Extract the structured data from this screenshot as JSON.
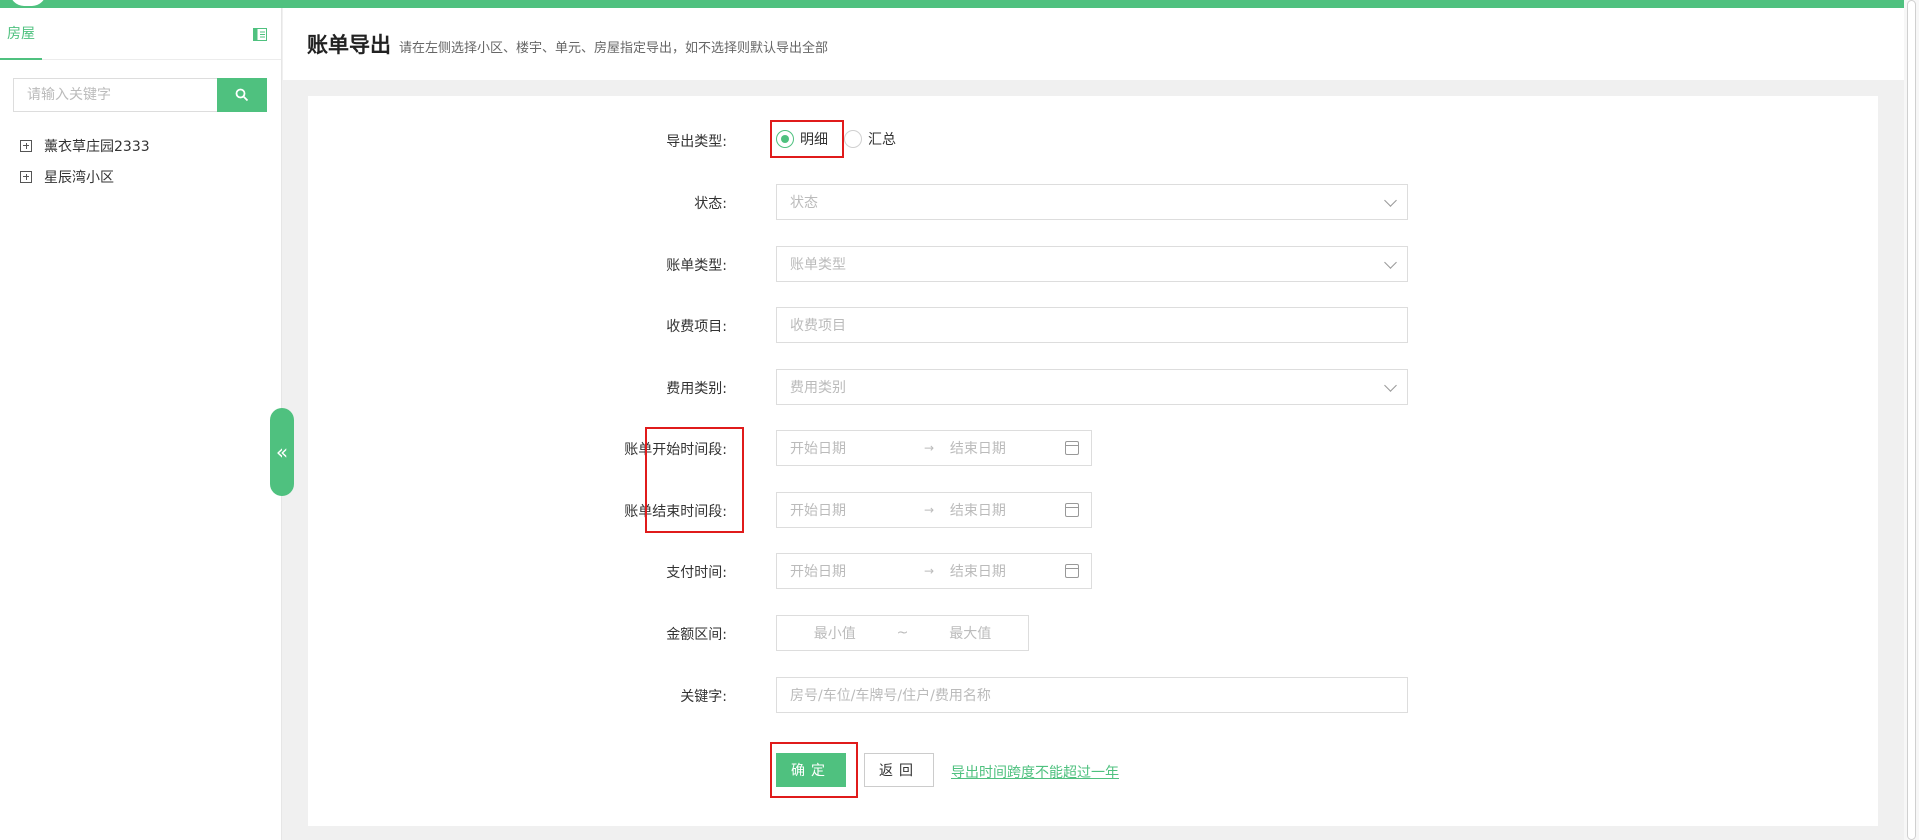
{
  "sidebar": {
    "tab_label": "房屋",
    "search_placeholder": "请输入关键字",
    "tree": [
      {
        "label": "薰衣草庄园2333"
      },
      {
        "label": "星辰湾小区"
      }
    ],
    "collapse_glyph": "«"
  },
  "header": {
    "title": "账单导出",
    "subtitle": "请在左侧选择小区、楼宇、单元、房屋指定导出，如不选择则默认导出全部"
  },
  "form": {
    "export_type": {
      "label": "导出类型:",
      "options": [
        {
          "label": "明细",
          "checked": true
        },
        {
          "label": "汇总",
          "checked": false
        }
      ]
    },
    "status": {
      "label": "状态:",
      "placeholder": "状态"
    },
    "bill_type": {
      "label": "账单类型:",
      "placeholder": "账单类型"
    },
    "charge_item": {
      "label": "收费项目:",
      "placeholder": "收费项目"
    },
    "fee_category": {
      "label": "费用类别:",
      "placeholder": "费用类别"
    },
    "bill_start_range": {
      "label": "账单开始时间段:",
      "start": "开始日期",
      "end": "结束日期"
    },
    "bill_end_range": {
      "label": "账单结束时间段:",
      "start": "开始日期",
      "end": "结束日期"
    },
    "pay_time": {
      "label": "支付时间:",
      "start": "开始日期",
      "end": "结束日期"
    },
    "amount_range": {
      "label": "金额区间:",
      "min": "最小值",
      "sep": "~",
      "max": "最大值"
    },
    "keyword": {
      "label": "关键字:",
      "placeholder": "房号/车位/车牌号/住户/费用名称"
    },
    "range_arrow": "→"
  },
  "actions": {
    "confirm": "确定",
    "back": "返回",
    "notice": "导出时间跨度不能超过一年"
  },
  "colors": {
    "accent": "#4fc17f",
    "highlight": "#e01b1b"
  }
}
